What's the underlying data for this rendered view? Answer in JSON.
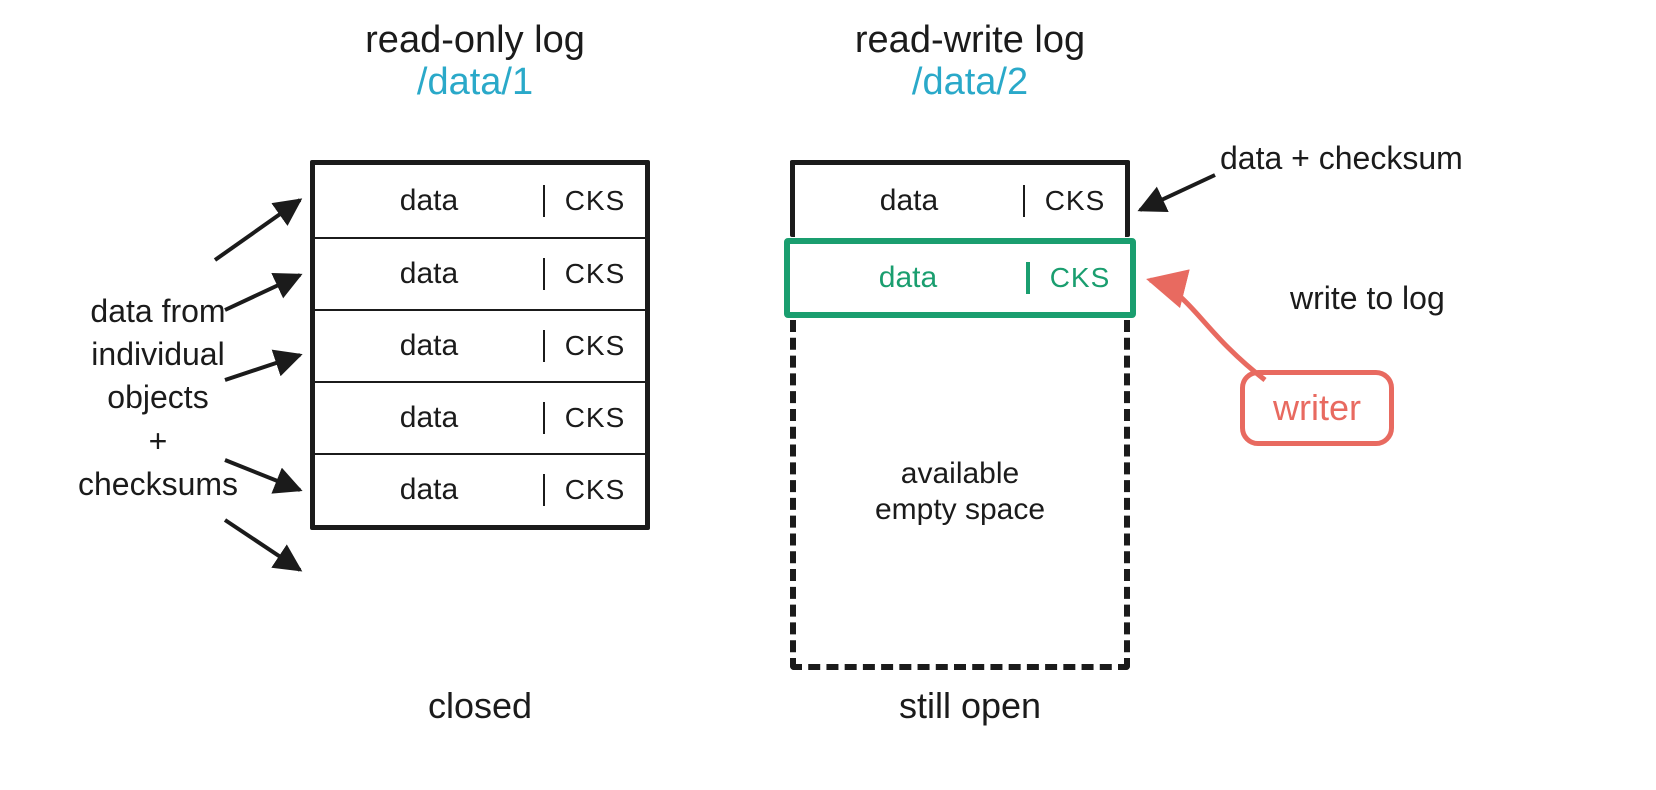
{
  "left": {
    "title": "read-only log",
    "path": "/data/1",
    "rows": [
      {
        "data": "data",
        "cks": "CKS"
      },
      {
        "data": "data",
        "cks": "CKS"
      },
      {
        "data": "data",
        "cks": "CKS"
      },
      {
        "data": "data",
        "cks": "CKS"
      },
      {
        "data": "data",
        "cks": "CKS"
      }
    ],
    "caption": "closed",
    "side_label": "data from\nindividual\nobjects\n+\nchecksums"
  },
  "right": {
    "title": "read-write log",
    "path": "/data/2",
    "rows": [
      {
        "data": "data",
        "cks": "CKS"
      }
    ],
    "active_row": {
      "data": "data",
      "cks": "CKS"
    },
    "empty_label": "available\nempty space",
    "caption": "still open",
    "anno_top": "data + checksum",
    "anno_write": "write to log",
    "writer_label": "writer"
  },
  "colors": {
    "accent_path": "#2aa9c9",
    "accent_green": "#1a9e6f",
    "accent_red": "#e86a60",
    "ink": "#1b1b1b"
  }
}
